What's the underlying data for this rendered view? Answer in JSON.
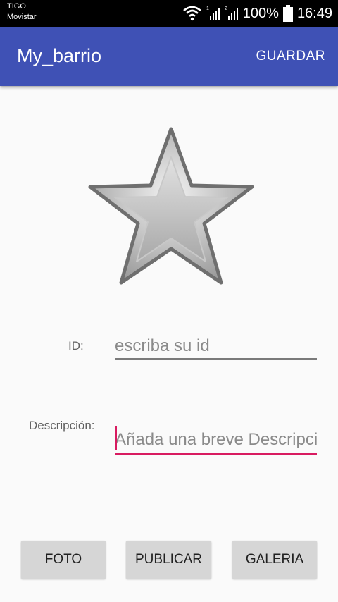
{
  "status_bar": {
    "carrier_1": "TIGO",
    "carrier_2": "Movistar",
    "battery": "100%",
    "time": "16:49",
    "icons": [
      "wifi-icon",
      "signal-sim1-icon",
      "signal-sim2-icon",
      "battery-icon"
    ]
  },
  "app_bar": {
    "title": "My_barrio",
    "action": "GUARDAR",
    "color": "#3f51b5"
  },
  "image": {
    "icon": "star-icon"
  },
  "form": {
    "id_label": "ID:",
    "id_placeholder": "escriba su id",
    "desc_label": "Descripción:",
    "desc_placeholder": "Añada una breve Descripción",
    "accent_color": "#d81b60"
  },
  "buttons": {
    "foto": "FOTO",
    "publicar": "PUBLICAR",
    "galeria": "GALERIA"
  }
}
